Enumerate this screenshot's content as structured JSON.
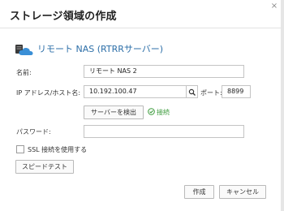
{
  "dialog": {
    "title": "ストレージ領域の作成",
    "close_glyph": "×"
  },
  "service": {
    "title": "リモート NAS (RTRRサーバー)",
    "icon": "cloud-icon"
  },
  "form": {
    "name_label": "名前:",
    "name_value": "リモート NAS 2",
    "host_label": "IP アドレス/ホスト名:",
    "host_value": "10.192.100.47",
    "port_label": "ポート:",
    "port_value": "8899",
    "detect_button": "サーバーを検出",
    "status_text": "接続",
    "password_label": "パスワード:",
    "password_value": "",
    "ssl_label": "SSL 接続を使用する",
    "ssl_checked": false,
    "speed_test_button": "スピードテスト"
  },
  "footer": {
    "create_button": "作成",
    "cancel_button": "キャンセル"
  },
  "colors": {
    "accent_blue": "#2d6fa8",
    "success_green": "#3a9a3a"
  }
}
